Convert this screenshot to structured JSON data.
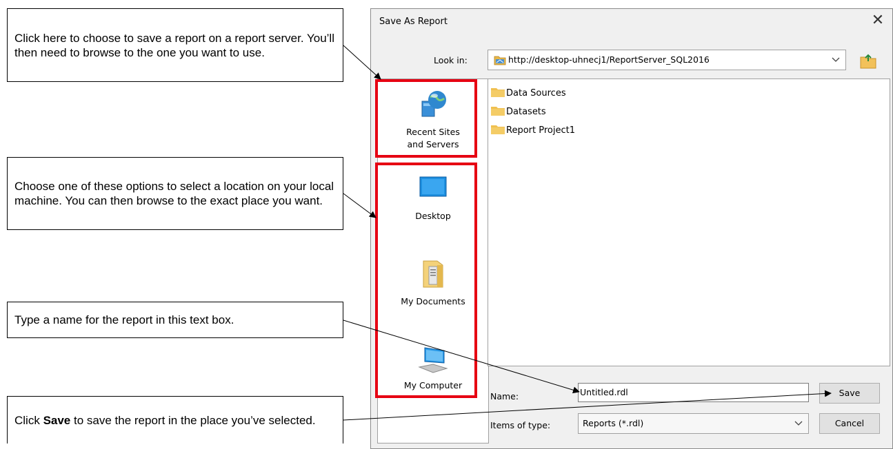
{
  "callouts": {
    "report_server": "Click here to choose to save a report on a report server.  You’ll then need to browse to the one you want to use.",
    "local_machine": "Choose one of these options to select a location on your local machine.  You can then browse to the exact place you want.",
    "type_name": "Type a name for the report in this text box.",
    "save_prefix": "Click ",
    "save_bold": "Save",
    "save_suffix": " to save the report in the place you’ve selected."
  },
  "dialog": {
    "title": "Save As Report",
    "look_in_label": "Look in:",
    "look_in_value": "http://desktop-uhnecj1/ReportServer_SQL2016",
    "places": [
      {
        "label": "Recent Sites\nand Servers",
        "icon": "globe-server-icon"
      },
      {
        "label": "Desktop",
        "icon": "desktop-icon"
      },
      {
        "label": "My Documents",
        "icon": "documents-folder-icon"
      },
      {
        "label": "My Computer",
        "icon": "computer-icon"
      }
    ],
    "files": [
      "Data Sources",
      "Datasets",
      "Report Project1"
    ],
    "name_label": "Name:",
    "name_value": "Untitled.rdl",
    "type_label": "Items of type:",
    "type_value": "Reports (*.rdl)",
    "save_button": "Save",
    "cancel_button": "Cancel"
  },
  "colors": {
    "highlight": "#e60012",
    "folder": "#f0c050"
  }
}
